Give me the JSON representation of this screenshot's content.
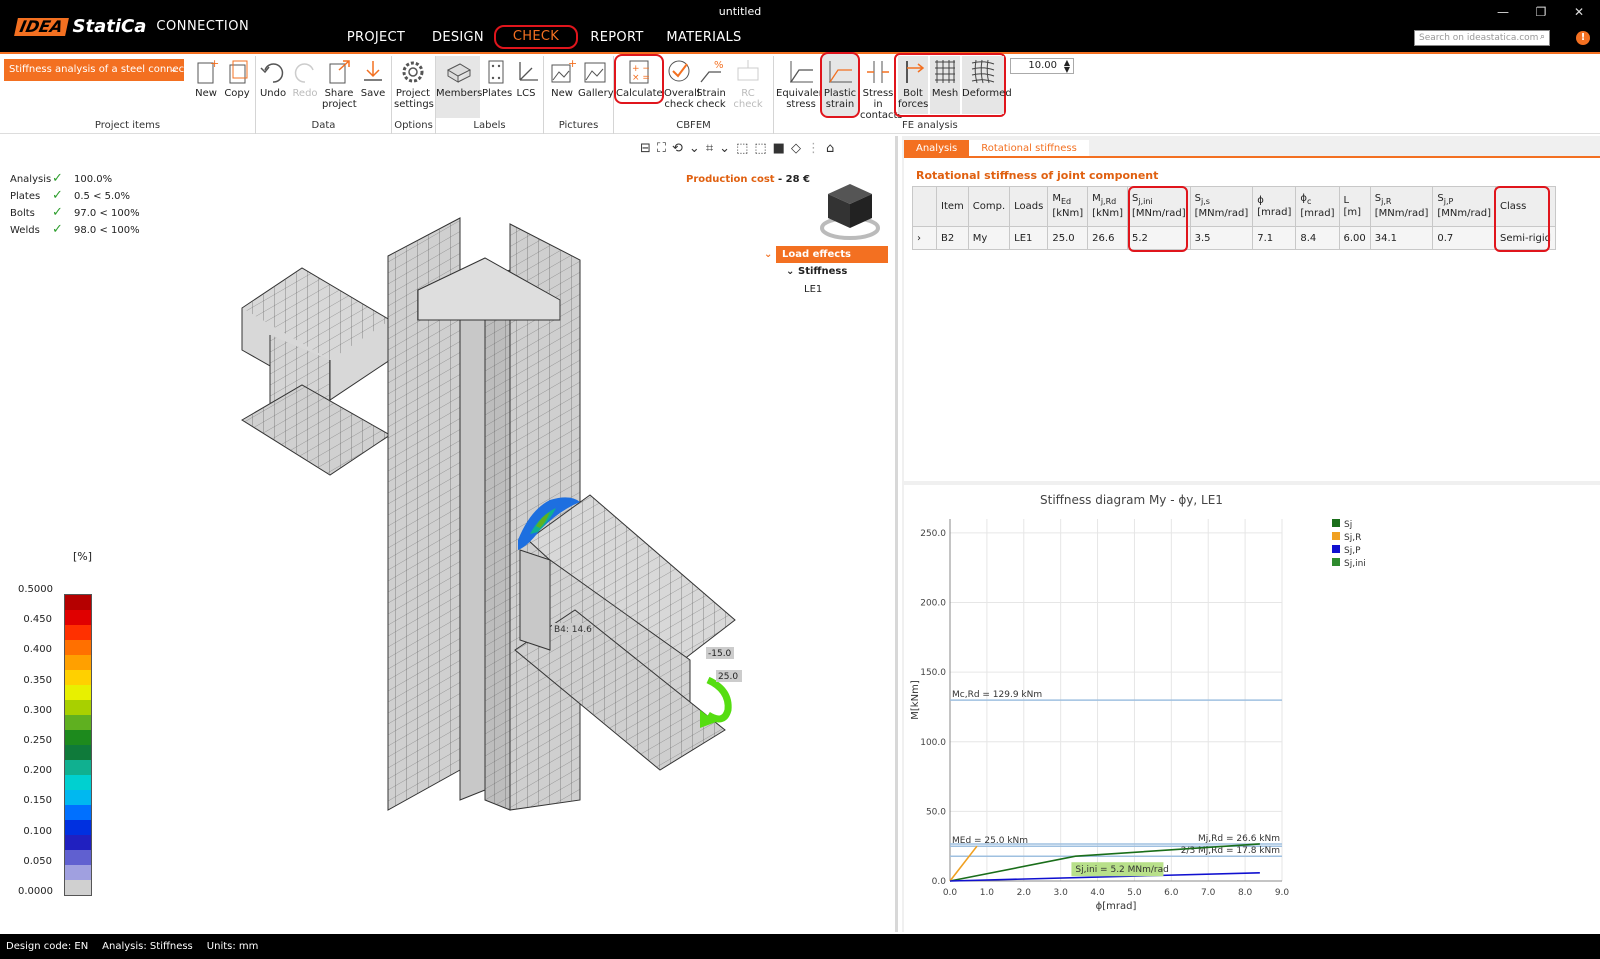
{
  "window": {
    "brand": "IDEA",
    "product": "StatiCa",
    "module": "CONNECTION",
    "doc_title": "untitled",
    "controls": [
      "—",
      "❐",
      "✕"
    ]
  },
  "menu": [
    "PROJECT",
    "DESIGN",
    "CHECK",
    "REPORT",
    "MATERIALS"
  ],
  "search_placeholder": "Search on ideastatica.com",
  "ribbon": {
    "project_dropdown": "Stiffness analysis of a steel connecti",
    "groups": {
      "project_items": "Project items",
      "data": "Data",
      "options": "Options",
      "labels": "Labels",
      "pictures": "Pictures",
      "cbfem": "CBFEM",
      "fe_analysis": "FE analysis"
    },
    "buttons": {
      "new": "New",
      "copy": "Copy",
      "undo": "Undo",
      "redo": "Redo",
      "share_1": "Share",
      "share_2": "project",
      "save": "Save",
      "settings_1": "Project",
      "settings_2": "settings",
      "members": "Members",
      "plates": "Plates",
      "lcs": "LCS",
      "pic_new": "New",
      "gallery": "Gallery",
      "calculate": "Calculate",
      "overall_1": "Overall",
      "overall_2": "check",
      "strain_1": "Strain",
      "strain_2": "check",
      "rc_check": "RC check",
      "equiv_1": "Equivalent",
      "equiv_2": "stress",
      "plastic_1": "Plastic",
      "plastic_2": "strain",
      "stress_1": "Stress in",
      "stress_2": "contacts",
      "bolt_1": "Bolt",
      "bolt_2": "forces",
      "mesh": "Mesh",
      "deformed": "Deformed"
    },
    "spin_value": "10.00"
  },
  "results": [
    {
      "label": "Analysis",
      "value": "100.0%"
    },
    {
      "label": "Plates",
      "value": "0.5 < 5.0%"
    },
    {
      "label": "Bolts",
      "value": "97.0 < 100%"
    },
    {
      "label": "Welds",
      "value": "98.0 < 100%"
    }
  ],
  "production_cost": {
    "label": "Production cost",
    "value": "- 28 €"
  },
  "tree": {
    "header": "Load effects",
    "node": "Stiffness",
    "leaf": "LE1"
  },
  "model_labels": {
    "bolt": "B4: 14.6",
    "load1": "-15.0",
    "load2": "25.0"
  },
  "legend": {
    "unit": "[%]",
    "ticks": [
      "0.5000",
      "0.450",
      "0.400",
      "0.350",
      "0.300",
      "0.250",
      "0.200",
      "0.150",
      "0.100",
      "0.050",
      "0.0000"
    ],
    "colors": [
      "#b50000",
      "#e00000",
      "#ff3000",
      "#ff7000",
      "#ffa000",
      "#ffd000",
      "#e8f000",
      "#a8d000",
      "#5fb020",
      "#1d8a1d",
      "#0f7a3a",
      "#10b090",
      "#00d0d0",
      "#00b8f0",
      "#0070ff",
      "#0030e0",
      "#2020c0",
      "#6060d0",
      "#a0a0e0",
      "#d0d0d0"
    ]
  },
  "tabs": [
    "Analysis",
    "Rotational stiffness"
  ],
  "table": {
    "title": "Rotational stiffness of joint component",
    "headers": [
      {
        "main": "Item",
        "sub": ""
      },
      {
        "main": "Comp.",
        "sub": ""
      },
      {
        "main": "Loads",
        "sub": ""
      },
      {
        "main": "M",
        "idx": "Ed",
        "sub": "[kNm]"
      },
      {
        "main": "M",
        "idx": "j,Rd",
        "sub": "[kNm]"
      },
      {
        "main": "S",
        "idx": "j,ini",
        "sub": "[MNm/rad]"
      },
      {
        "main": "S",
        "idx": "j,s",
        "sub": "[MNm/rad]"
      },
      {
        "main": "ϕ",
        "idx": "",
        "sub": "[mrad]"
      },
      {
        "main": "ϕ",
        "idx": "c",
        "sub": "[mrad]"
      },
      {
        "main": "L",
        "idx": "",
        "sub": "[m]"
      },
      {
        "main": "S",
        "idx": "j,R",
        "sub": "[MNm/rad]"
      },
      {
        "main": "S",
        "idx": "j,P",
        "sub": "[MNm/rad]"
      },
      {
        "main": "Class",
        "sub": ""
      }
    ],
    "rows": [
      [
        "B2",
        "My",
        "LE1",
        "25.0",
        "26.6",
        "5.2",
        "3.5",
        "7.1",
        "8.4",
        "6.00",
        "34.1",
        "0.7",
        "Semi-rigid"
      ]
    ]
  },
  "chart_data": {
    "type": "line",
    "title": "Stiffness diagram My - ϕy, LE1",
    "xlabel": "ϕ[mrad]",
    "ylabel": "M[kNm]",
    "xlim": [
      0,
      9
    ],
    "ylim": [
      0,
      260
    ],
    "xticks": [
      "0.0",
      "1.0",
      "2.0",
      "3.0",
      "4.0",
      "5.0",
      "6.0",
      "7.0",
      "8.0",
      "9.0"
    ],
    "yticks": [
      "0.0",
      "50.0",
      "100.0",
      "150.0",
      "200.0",
      "250.0"
    ],
    "grid": true,
    "legend_position": "top-right",
    "legend": [
      {
        "name": "Sj",
        "color": "#1a6e1a"
      },
      {
        "name": "Sj,R",
        "color": "#f0a020"
      },
      {
        "name": "Sj,P",
        "color": "#1010d0"
      },
      {
        "name": "Sj,ini",
        "color": "#2e8b2e"
      }
    ],
    "series": [
      {
        "name": "Sj",
        "color": "#1a6e1a",
        "x": [
          0,
          3.4,
          8.4
        ],
        "y": [
          0,
          17.8,
          26.6
        ]
      },
      {
        "name": "Sj,R",
        "color": "#f0a020",
        "x": [
          0,
          0.73
        ],
        "y": [
          0,
          25.0
        ]
      },
      {
        "name": "Sj,P",
        "color": "#1010d0",
        "x": [
          0,
          8.4
        ],
        "y": [
          0,
          5.9
        ]
      }
    ],
    "hlines": [
      {
        "y": 129.9,
        "label": "Mc,Rd = 129.9 kNm",
        "color": "#9fc0e0",
        "pos": "left"
      },
      {
        "y": 26.6,
        "label": "Mj,Rd = 26.6 kNm",
        "color": "#9fc0e0",
        "pos": "right"
      },
      {
        "y": 25.0,
        "label": "MEd = 25.0 kNm",
        "color": "#9fc0e0",
        "pos": "left"
      },
      {
        "y": 17.8,
        "label": "2/3 Mj,Rd = 17.8 kNm",
        "color": "#9fc0e0",
        "pos": "right"
      }
    ],
    "annotation": {
      "x": 3.4,
      "y": 17.8,
      "label": "Sj,ini = 5.2 MNm/rad"
    }
  },
  "status": {
    "code": "Design code: EN",
    "analysis": "Analysis: Stiffness",
    "units": "Units: mm"
  }
}
